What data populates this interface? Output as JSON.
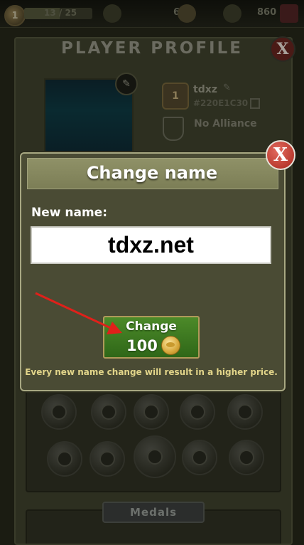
{
  "topbar": {
    "level": "1",
    "xp_text": "13 / 25",
    "xp_fraction": 0.52,
    "resource_1": "640",
    "resource_2": "860"
  },
  "profile": {
    "title": "PLAYER PROFILE",
    "player_name": "tdxz",
    "player_id": "#220E1C30",
    "rank": "1",
    "alliance": "No Alliance",
    "medals_tab": "Medals"
  },
  "dialog": {
    "title": "Change name",
    "close_label": "X",
    "new_name_label": "New name:",
    "name_value": "tdxz.net",
    "change_label": "Change",
    "price": "100",
    "warning": "Every new name change will result in a higher price."
  },
  "icons": {
    "coin": "gold-coin-icon",
    "edit": "pencil-icon",
    "copy": "copy-icon",
    "close": "close-icon"
  },
  "colors": {
    "accent_green": "#3f7c22",
    "close_red": "#c0392b",
    "warning_text": "#e2d58a",
    "annotation_arrow": "#e0201a"
  }
}
